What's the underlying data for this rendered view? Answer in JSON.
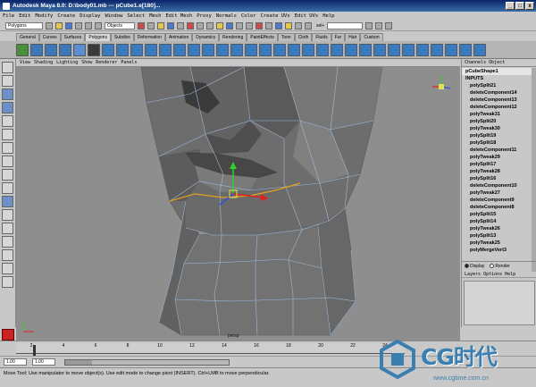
{
  "window": {
    "title": "Autodesk Maya 8.0: D:\\body01.mb  ---  pCube1.e[180]...",
    "min_label": "_",
    "max_label": "□",
    "close_label": "x"
  },
  "menubar": {
    "items": [
      "File",
      "Edit",
      "Modify",
      "Create",
      "Display",
      "Window",
      "Select",
      "Mesh",
      "Edit Mesh",
      "Proxy",
      "Normals",
      "Color",
      "Create UVs",
      "Edit UVs",
      "Help"
    ]
  },
  "statusline": {
    "mode": "Polygons",
    "selection_mask": "Objects",
    "sel_label": "sel+"
  },
  "shelf": {
    "tabs": [
      "General",
      "Curves",
      "Surfaces",
      "Polygons",
      "Subdivs",
      "Deformation",
      "Animation",
      "Dynamics",
      "Rendering",
      "PaintEffects",
      "Toon",
      "Cloth",
      "Fluids",
      "Fur",
      "Hair",
      "Custom"
    ],
    "active_tab": "Polygons"
  },
  "viewport": {
    "menu": [
      "View",
      "Shading",
      "Lighting",
      "Show",
      "Renderer",
      "Panels"
    ],
    "camera": "persp"
  },
  "channel_box": {
    "header": "Channels  Object",
    "selected_node": "pCubeShape1",
    "inputs_label": "INPUTS",
    "history": [
      "polySplit21",
      "deleteComponent14",
      "deleteComponent13",
      "deleteComponent12",
      "polyTweak31",
      "polySplit20",
      "polyTweak30",
      "polySplit19",
      "polySplit18",
      "deleteComponent11",
      "polyTweak29",
      "polySplit17",
      "polyTweak28",
      "polySplit16",
      "deleteComponent10",
      "polyTweak27",
      "deleteComponent9",
      "deleteComponent8",
      "polySplit15",
      "polySplit14",
      "polyTweak26",
      "polySplit13",
      "polyTweak25",
      "polyMergeVert3"
    ]
  },
  "layer_editor": {
    "display_label": "Display",
    "render_label": "Render",
    "menu": "Layers  Options  Help"
  },
  "timeline": {
    "ticks": [
      "2",
      "4",
      "6",
      "8",
      "10",
      "12",
      "14",
      "16",
      "18",
      "20",
      "22",
      "24"
    ],
    "range_start": "1.00",
    "range_current": "1.00"
  },
  "helpline": {
    "text": "Move Tool: Use manipulator to move object(s). Use edit mode to change pivot (INSERT). Ctrl+LMB to move perpendicular."
  },
  "watermark": {
    "brand": "CG时代",
    "url": "www.cgtime.com.cn"
  },
  "colors": {
    "title_bar": "#0a246a",
    "viewport_bg": "#8e8e8e",
    "mesh_fill": "#6e6e6e",
    "mesh_wire": "#a3c4e8",
    "selected_edge": "#e0a020",
    "watermark": "#3a7fb0"
  }
}
